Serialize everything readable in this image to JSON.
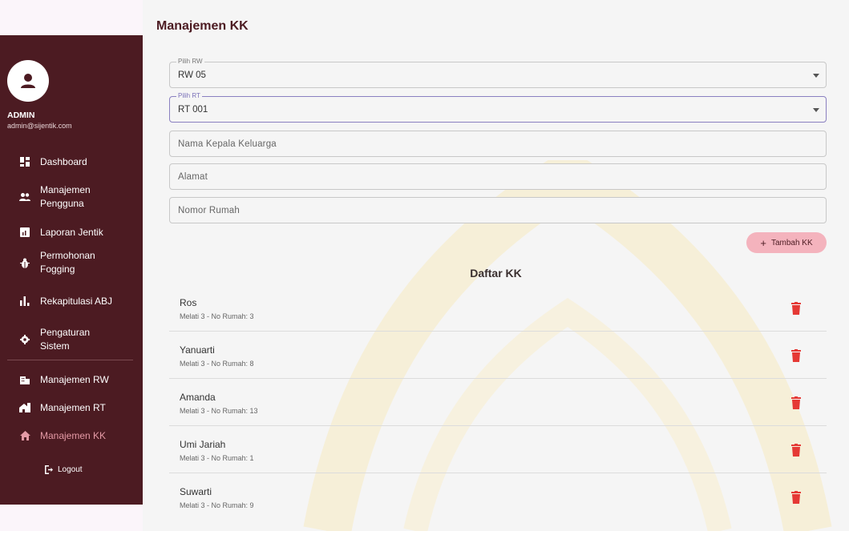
{
  "page_title": "Manajemen KK",
  "user": {
    "name": "ADMIN",
    "email": "admin@sijentik.com"
  },
  "sidebar": {
    "items": [
      {
        "label": "Dashboard",
        "icon": "dashboard-icon"
      },
      {
        "label": "Manajemen Pengguna",
        "icon": "people-icon"
      },
      {
        "label": "Laporan Jentik",
        "icon": "report-icon"
      },
      {
        "label": "Permohonan Fogging",
        "icon": "bug-icon"
      },
      {
        "label": "Rekapitulasi ABJ",
        "icon": "bar-chart-icon"
      },
      {
        "label": "Pengaturan Sistem",
        "icon": "gear-icon"
      },
      {
        "label": "Manajemen RW",
        "icon": "building-icon"
      },
      {
        "label": "Manajemen RT",
        "icon": "house-icon"
      },
      {
        "label": "Manajemen KK",
        "icon": "home-icon",
        "active": true
      }
    ],
    "logout": "Logout"
  },
  "form": {
    "rw_label": "Pilih RW",
    "rw_value": "RW 05",
    "rt_label": "Pilih RT",
    "rt_value": "RT 001",
    "kepala_placeholder": "Nama Kepala Keluarga",
    "alamat_placeholder": "Alamat",
    "nomor_placeholder": "Nomor Rumah",
    "add_button": "Tambah KK"
  },
  "list_title": "Daftar KK",
  "kk_list": [
    {
      "name": "Ros",
      "detail": "Melati 3 - No Rumah: 3"
    },
    {
      "name": "Yanuarti",
      "detail": "Melati 3 - No Rumah: 8"
    },
    {
      "name": "Amanda",
      "detail": "Melati 3 - No Rumah: 13"
    },
    {
      "name": "Umi Jariah",
      "detail": "Melati 3 - No Rumah: 1"
    },
    {
      "name": "Suwarti",
      "detail": "Melati 3 - No Rumah: 9"
    }
  ],
  "colors": {
    "sidebar": "#4c1b22",
    "accent": "#e59aa6",
    "button": "#f4b3bd",
    "delete": "#e53935"
  }
}
